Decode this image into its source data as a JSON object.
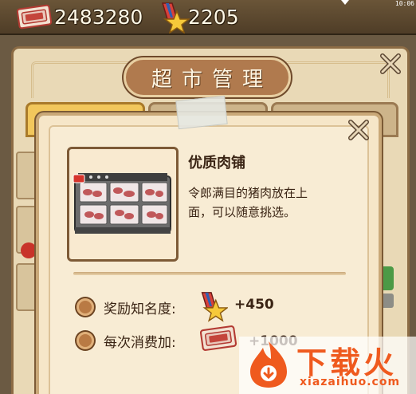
{
  "currency": {
    "money_value": "2483280",
    "money_icon_label": "",
    "fame_value": "2205"
  },
  "status_bar": {
    "time": "10:06"
  },
  "supermarket": {
    "title": "超市管理"
  },
  "item": {
    "name": "优质肉铺",
    "description": "令郎满目的猪肉放在上面，可以随意挑选。"
  },
  "rewards": [
    {
      "label": "奖励知名度:",
      "icon": "fame-star-icon",
      "value": "+450"
    },
    {
      "label": "每次消费加:",
      "icon": "money-bill-icon",
      "value": "+1000"
    }
  ],
  "watermark": {
    "title": "下载火",
    "url": "xiazaihuo.com"
  },
  "colors": {
    "panel_bg": "#f6e6c8",
    "frame_brown": "#7d5a36",
    "accent_orange": "#ef5a1e",
    "title_plate": "#b07a4e"
  }
}
